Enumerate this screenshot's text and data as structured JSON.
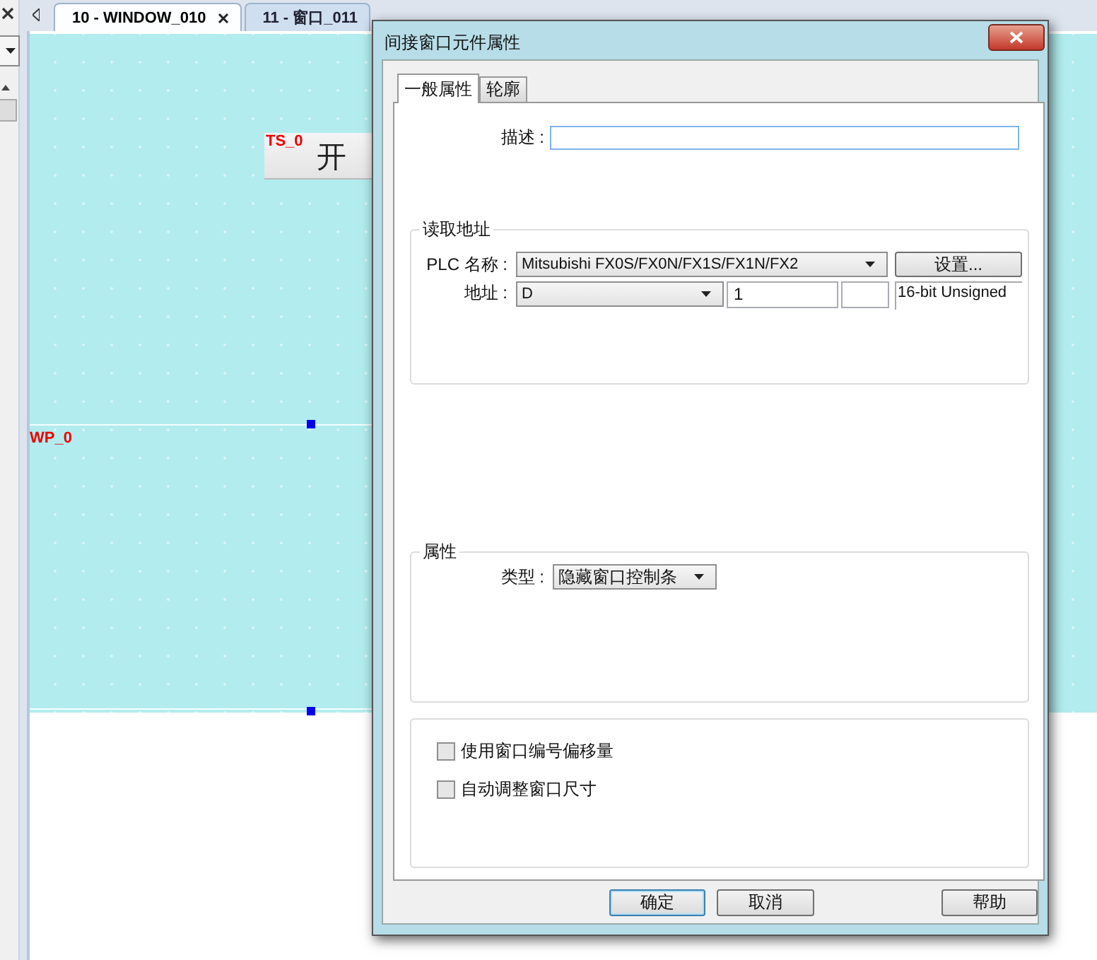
{
  "editor_tabs": [
    {
      "label": "10 - WINDOW_010",
      "selected": true,
      "closable": true
    },
    {
      "label": "11 - 窗口_011",
      "selected": false,
      "closable": false
    }
  ],
  "canvas": {
    "objects": [
      {
        "kind": "button",
        "tag": "TS_0",
        "text": "开"
      },
      {
        "kind": "window",
        "tag": "WP_0"
      }
    ]
  },
  "dialog": {
    "title": "间接窗口元件属性",
    "tabs": [
      {
        "label": "一般属性",
        "selected": true
      },
      {
        "label": "轮廓",
        "selected": false
      }
    ],
    "description": {
      "label": "描述 :"
    },
    "read_address": {
      "title": "读取地址",
      "plc": {
        "label": "PLC 名称 :",
        "value": "Mitsubishi FX0S/FX0N/FX1S/FX1N/FX2"
      },
      "settings_button": "设置...",
      "address": {
        "label": "地址 :",
        "device": "D",
        "value": "1",
        "data_type": "16-bit Unsigned"
      }
    },
    "attributes": {
      "title": "属性",
      "type": {
        "label": "类型 :",
        "value": "隐藏窗口控制条"
      }
    },
    "options": [
      {
        "label": "使用窗口编号偏移量",
        "checked": false
      },
      {
        "label": "自动调整窗口尺寸",
        "checked": false
      }
    ],
    "buttons": [
      {
        "label": "确定",
        "focused": true
      },
      {
        "label": "取消",
        "focused": false
      },
      {
        "label": "帮助",
        "focused": false
      }
    ]
  }
}
